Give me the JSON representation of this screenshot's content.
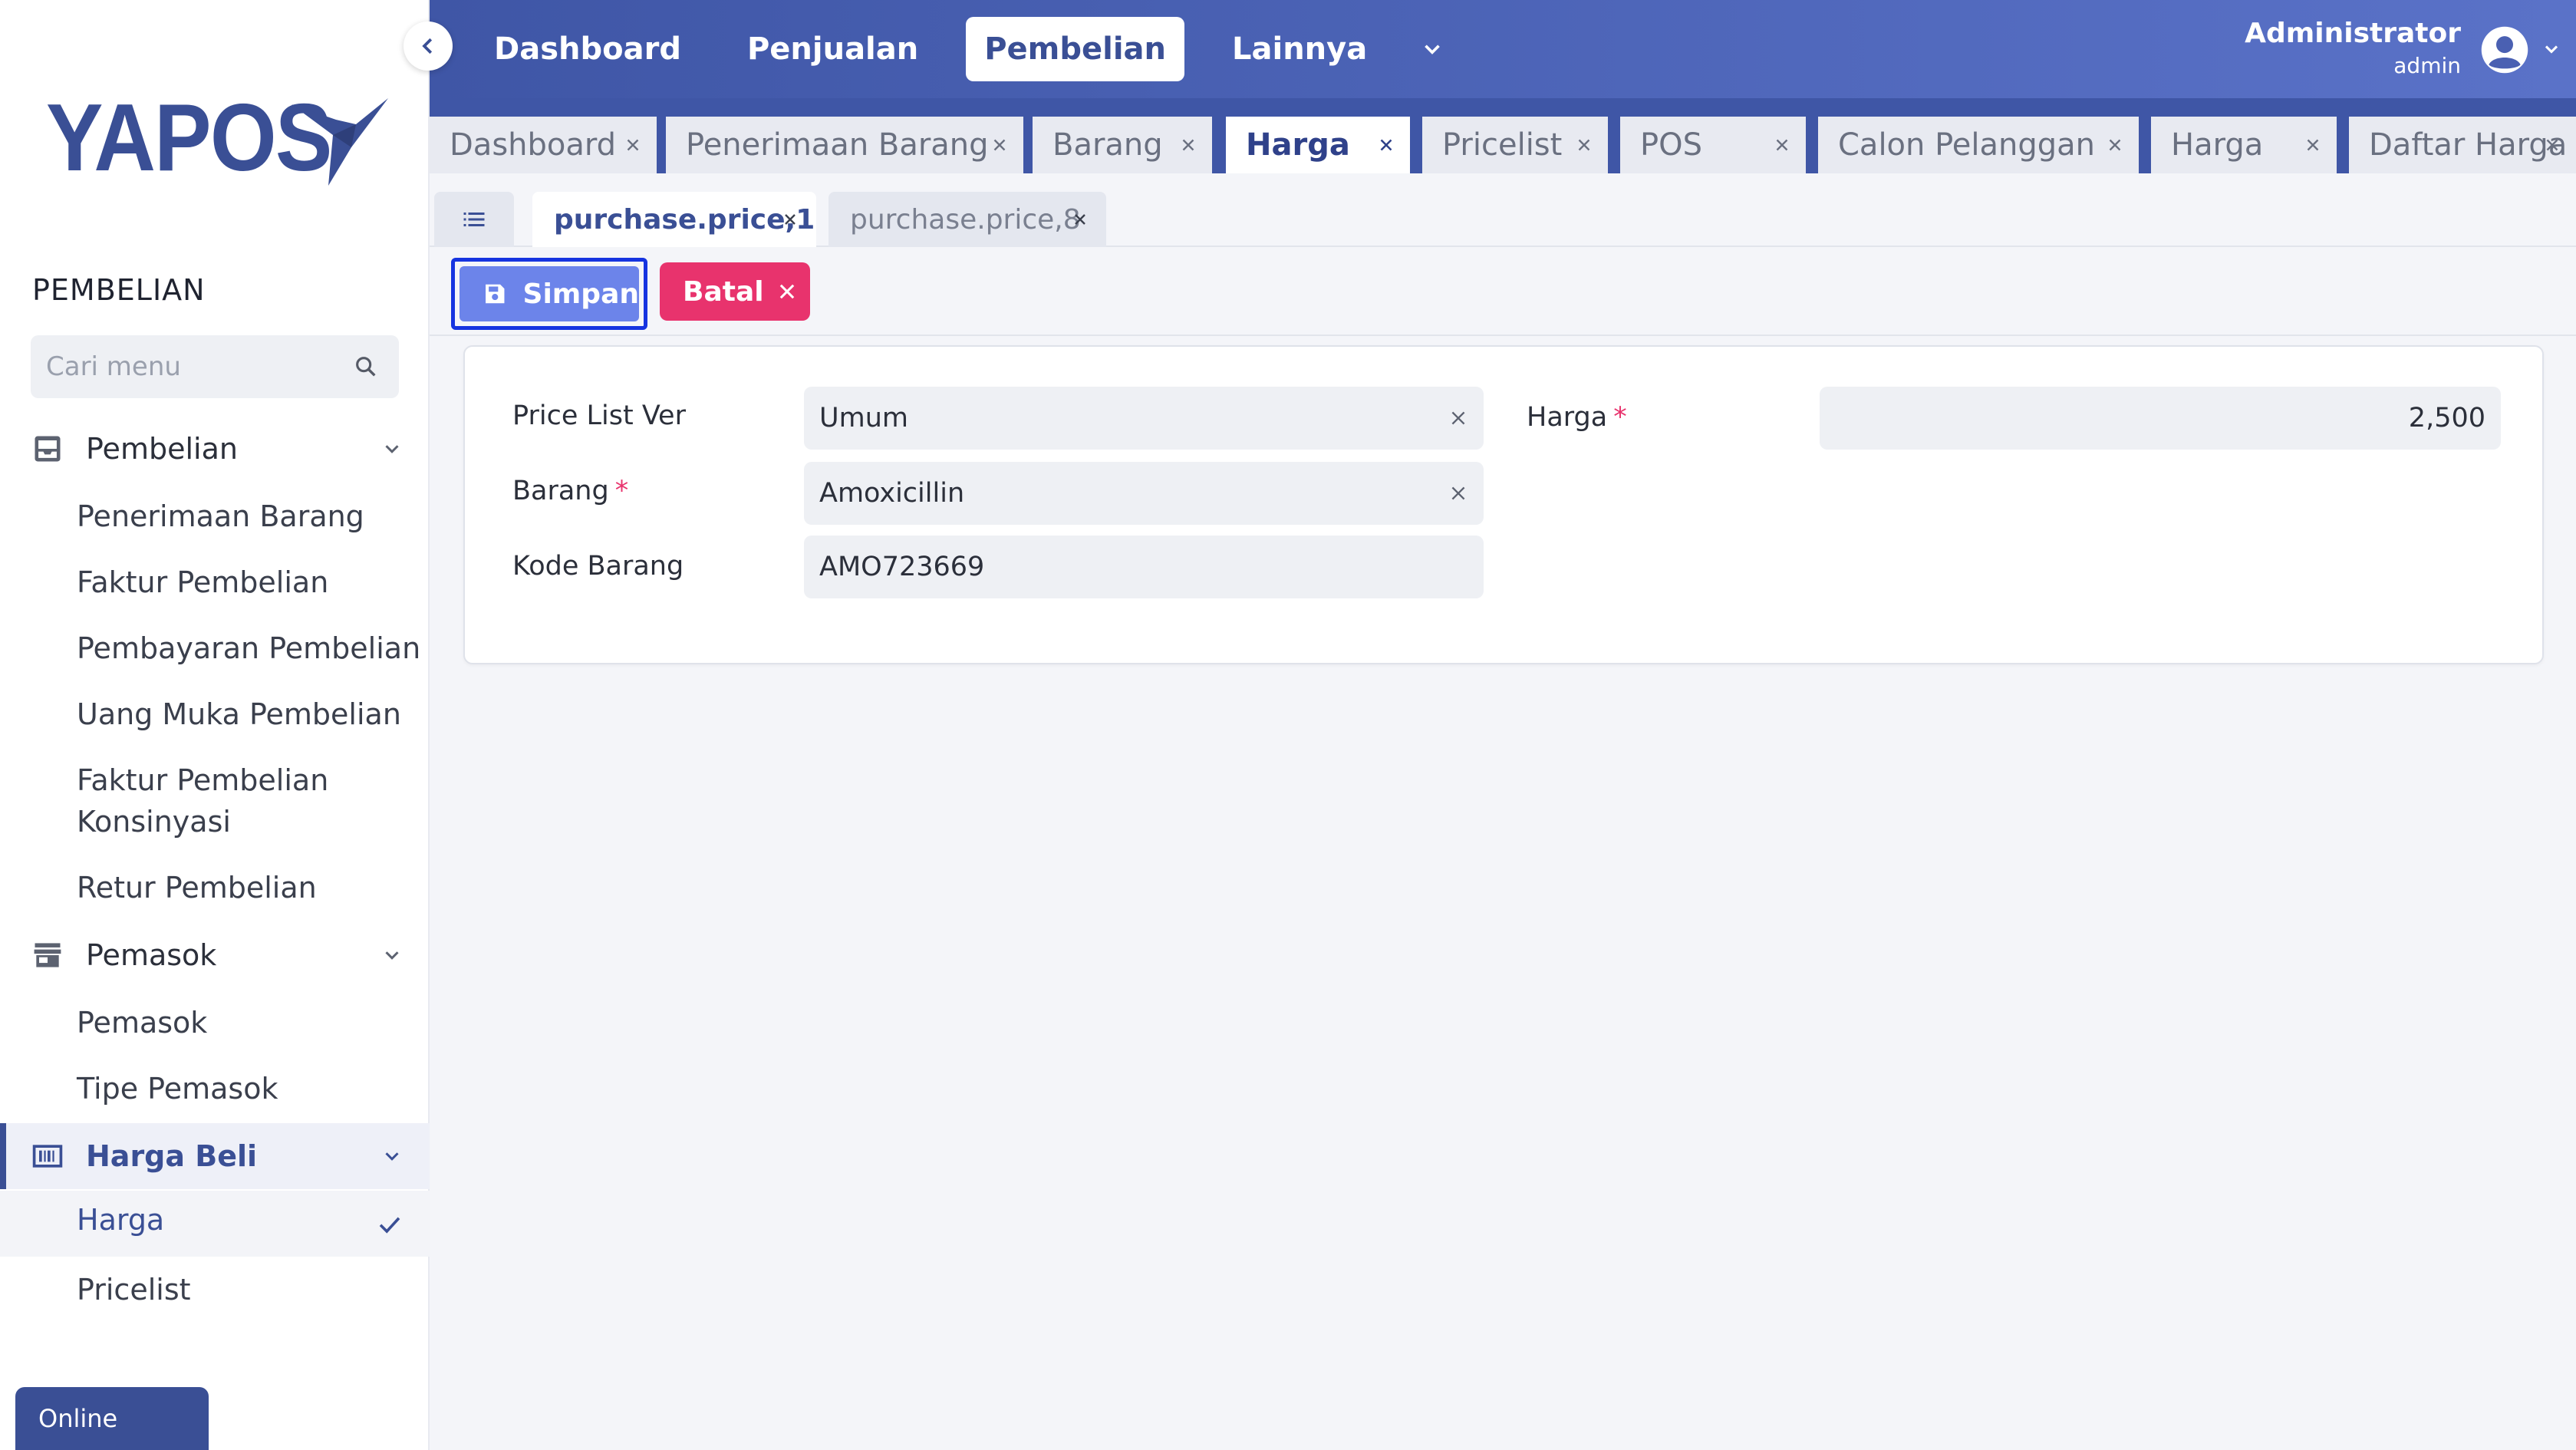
{
  "app": {
    "logo_text": "YAPOS"
  },
  "sidebar": {
    "section_title": "PEMBELIAN",
    "search_placeholder": "Cari menu",
    "groups": [
      {
        "label": "Pembelian",
        "icon": "inbox-icon",
        "items": [
          "Penerimaan Barang",
          "Faktur Pembelian",
          "Pembayaran Pembelian",
          "Uang Muka Pembelian",
          "Faktur Pembelian Konsinyasi",
          "Retur Pembelian"
        ]
      },
      {
        "label": "Pemasok",
        "icon": "store-icon",
        "items": [
          "Pemasok",
          "Tipe Pemasok"
        ]
      },
      {
        "label": "Harga Beli",
        "icon": "barcode-icon",
        "items": [
          "Harga",
          "Pricelist"
        ],
        "active_item": "Harga"
      }
    ],
    "status": "Online"
  },
  "topnav": {
    "items": [
      "Dashboard",
      "Penjualan",
      "Pembelian",
      "Lainnya"
    ],
    "active": "Pembelian"
  },
  "user": {
    "name": "Administrator",
    "role": "admin"
  },
  "tabs": [
    {
      "label": "Dashboard",
      "active": false
    },
    {
      "label": "Penerimaan Barang",
      "active": false
    },
    {
      "label": "Barang",
      "active": false
    },
    {
      "label": "Harga",
      "active": true
    },
    {
      "label": "Pricelist",
      "active": false
    },
    {
      "label": "POS",
      "active": false
    },
    {
      "label": "Calon Pelanggan",
      "active": false
    },
    {
      "label": "Harga",
      "active": false
    },
    {
      "label": "Daftar Harga",
      "active": false
    }
  ],
  "subtabs": [
    {
      "label": "purchase.price,1",
      "active": true
    },
    {
      "label": "purchase.price,8",
      "active": false
    }
  ],
  "toolbar": {
    "save_label": "Simpan",
    "cancel_label": "Batal"
  },
  "form": {
    "price_list_label": "Price List Ver",
    "price_list_value": "Umum",
    "barang_label": "Barang",
    "barang_value": "Amoxicillin",
    "kode_label": "Kode Barang",
    "kode_value": "AMO723669",
    "harga_label": "Harga",
    "harga_value": "2,500",
    "required_mark": "*"
  },
  "colors": {
    "primary": "#3f56a6",
    "save": "#6c84ea",
    "cancel": "#e8336d",
    "required": "#e8336d"
  }
}
